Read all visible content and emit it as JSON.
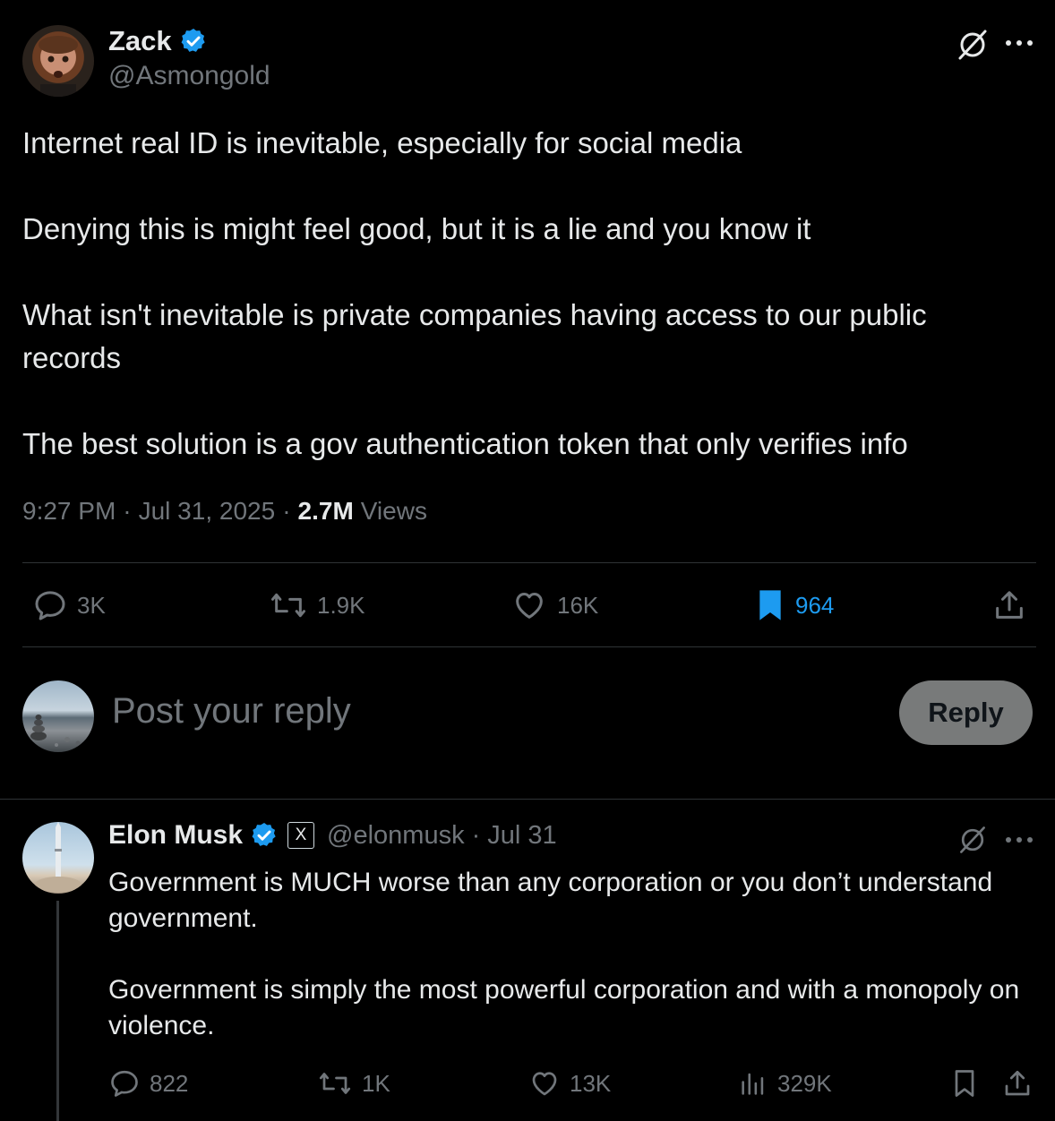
{
  "main_tweet": {
    "author_name": "Zack",
    "handle": "@Asmongold",
    "paragraphs": [
      "Internet real ID is inevitable, especially for social media",
      "Denying this is might feel good, but it is a lie and you know it",
      "What isn't inevitable is private companies having access to our public records",
      "The best solution is a gov authentication token that only verifies info"
    ],
    "time": "9:27 PM",
    "sep1": "·",
    "date": "Jul 31, 2025",
    "sep2": "·",
    "views_count": "2.7M",
    "views_label": "Views",
    "actions": {
      "replies": "3K",
      "reposts": "1.9K",
      "likes": "16K",
      "bookmarks": "964"
    }
  },
  "composer": {
    "placeholder": "Post your reply",
    "reply_button": "Reply"
  },
  "reply_tweet": {
    "author_name": "Elon Musk",
    "badge_letter": "X",
    "handle": "@elonmusk",
    "sep": "·",
    "date": "Jul 31",
    "paragraphs": [
      "Government is MUCH worse than any corporation or you don’t understand government.",
      "Government is simply the most powerful corporation and with a monopoly on violence."
    ],
    "actions": {
      "replies": "822",
      "reposts": "1K",
      "likes": "13K",
      "views": "329K"
    }
  },
  "colors": {
    "background": "#000000",
    "text": "#e7e9ea",
    "muted": "#71767b",
    "accent": "#1d9bf0",
    "divider": "#2f3336",
    "reply_button_bg": "#787a7a"
  },
  "icons": [
    "grok-icon",
    "more-icon",
    "verified-icon",
    "reply-icon",
    "repost-icon",
    "like-icon",
    "bookmark-icon",
    "share-icon",
    "views-icon"
  ]
}
